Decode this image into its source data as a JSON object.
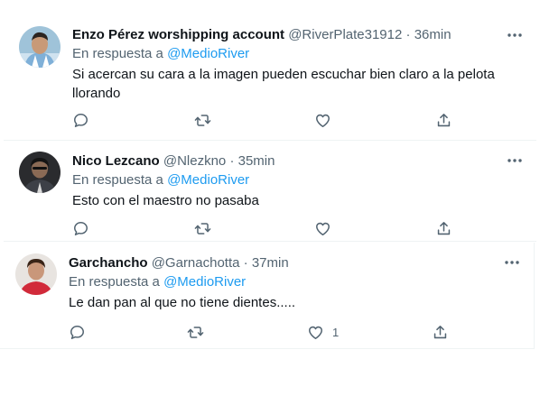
{
  "tweets": [
    {
      "name": "Enzo Pérez worshipping account",
      "handle": "@RiverPlate31912",
      "dot": "·",
      "time": "36min",
      "reply_prefix": "En respuesta a",
      "reply_to": "@MedioRiver",
      "text": "Si acercan su cara a la imagen pueden escuchar bien claro a la pelota llorando",
      "like_count": ""
    },
    {
      "name": "Nico Lezcano",
      "handle": "@Nlezkno",
      "dot": "·",
      "time": "35min",
      "reply_prefix": "En respuesta a",
      "reply_to": "@MedioRiver",
      "text": "Esto con el maestro no pasaba",
      "like_count": ""
    },
    {
      "name": "Garchancho",
      "handle": "@Garnachotta",
      "dot": "·",
      "time": "37min",
      "reply_prefix": "En respuesta a",
      "reply_to": "@MedioRiver",
      "text": "Le dan pan al que no tiene dientes.....",
      "like_count": "1"
    }
  ],
  "icons": [
    "reply-icon",
    "retweet-icon",
    "like-icon",
    "share-icon",
    "more-icon"
  ],
  "colors": {
    "link": "#1d9bf0",
    "secondary": "#536471",
    "text": "#0f1419"
  }
}
